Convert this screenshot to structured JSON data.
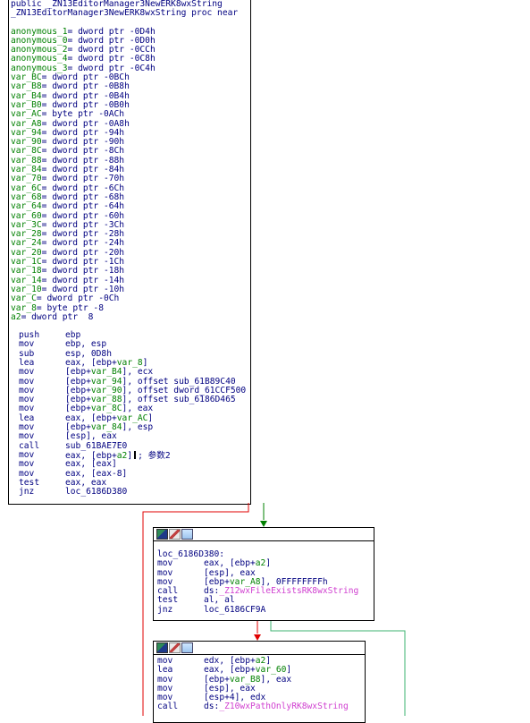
{
  "main_block": {
    "header_lines": [
      "public _ZN13EditorManager3NewERK8wxString",
      "_ZN13EditorManager3NewERK8wxString proc near"
    ],
    "vars": [
      [
        "anonymous_1",
        "= dword ptr -0D4h"
      ],
      [
        "anonymous_0",
        "= dword ptr -0D0h"
      ],
      [
        "anonymous_2",
        "= dword ptr -0CCh"
      ],
      [
        "anonymous_4",
        "= dword ptr -0C8h"
      ],
      [
        "anonymous_3",
        "= dword ptr -0C4h"
      ],
      [
        "var_BC",
        "= dword ptr -0BCh"
      ],
      [
        "var_B8",
        "= dword ptr -0B8h"
      ],
      [
        "var_B4",
        "= dword ptr -0B4h"
      ],
      [
        "var_B0",
        "= dword ptr -0B0h"
      ],
      [
        "var_AC",
        "= byte ptr -0ACh"
      ],
      [
        "var_A8",
        "= dword ptr -0A8h"
      ],
      [
        "var_94",
        "= dword ptr -94h"
      ],
      [
        "var_90",
        "= dword ptr -90h"
      ],
      [
        "var_8C",
        "= dword ptr -8Ch"
      ],
      [
        "var_88",
        "= dword ptr -88h"
      ],
      [
        "var_84",
        "= dword ptr -84h"
      ],
      [
        "var_70",
        "= dword ptr -70h"
      ],
      [
        "var_6C",
        "= dword ptr -6Ch"
      ],
      [
        "var_68",
        "= dword ptr -68h"
      ],
      [
        "var_64",
        "= dword ptr -64h"
      ],
      [
        "var_60",
        "= dword ptr -60h"
      ],
      [
        "var_3C",
        "= dword ptr -3Ch"
      ],
      [
        "var_28",
        "= dword ptr -28h"
      ],
      [
        "var_24",
        "= dword ptr -24h"
      ],
      [
        "var_20",
        "= dword ptr -20h"
      ],
      [
        "var_1C",
        "= dword ptr -1Ch"
      ],
      [
        "var_18",
        "= dword ptr -18h"
      ],
      [
        "var_14",
        "= dword ptr -14h"
      ],
      [
        "var_10",
        "= dword ptr -10h"
      ],
      [
        "var_C",
        "= dword ptr -0Ch"
      ],
      [
        "var_8",
        "= byte ptr -8"
      ],
      [
        "a2",
        "= dword ptr  8"
      ]
    ],
    "instructions": [
      {
        "op": "push",
        "args": "ebp"
      },
      {
        "op": "mov",
        "args": "ebp, esp"
      },
      {
        "op": "sub",
        "args": "esp, 0D8h"
      },
      {
        "op": "lea",
        "args": "eax, [ebp+var_8]"
      },
      {
        "op": "mov",
        "args": "[ebp+var_B4], ecx"
      },
      {
        "op": "mov",
        "args": "[ebp+var_94], offset sub_61B89C40"
      },
      {
        "op": "mov",
        "args": "[ebp+var_90], offset dword_61CCF500"
      },
      {
        "op": "mov",
        "args": "[ebp+var_88], offset sub_6186D465"
      },
      {
        "op": "mov",
        "args": "[ebp+var_8C], eax"
      },
      {
        "op": "lea",
        "args": "eax, [ebp+var_AC]"
      },
      {
        "op": "mov",
        "args": "[ebp+var_84], esp"
      },
      {
        "op": "mov",
        "args": "[esp], eax"
      },
      {
        "op": "call",
        "args": "sub_61BAE7E0"
      },
      {
        "op": "mov",
        "args": "eax, [ebp+a2]",
        "comment": "; 参数2"
      },
      {
        "op": "mov",
        "args": "eax, [eax]"
      },
      {
        "op": "mov",
        "args": "eax, [eax-8]"
      },
      {
        "op": "test",
        "args": "eax, eax"
      },
      {
        "op": "jnz",
        "args": "loc_6186D380"
      }
    ]
  },
  "block2": {
    "label": "loc_6186D380:",
    "instructions": [
      {
        "op": "mov",
        "args": "eax, [ebp+a2]"
      },
      {
        "op": "mov",
        "args": "[esp], eax"
      },
      {
        "op": "mov",
        "args": "[ebp+var_A8], 0FFFFFFFFh"
      },
      {
        "op": "call",
        "args_prefix": "ds:",
        "args_import": "_Z12wxFileExistsRK8wxString"
      },
      {
        "op": "test",
        "args": "al, al"
      },
      {
        "op": "jnz",
        "args": "loc_6186CF9A"
      }
    ]
  },
  "block3": {
    "instructions": [
      {
        "op": "mov",
        "args": "edx, [ebp+a2]"
      },
      {
        "op": "lea",
        "args": "eax, [ebp+var_60]"
      },
      {
        "op": "mov",
        "args": "[ebp+var_B8], eax"
      },
      {
        "op": "mov",
        "args": "[esp], eax"
      },
      {
        "op": "mov",
        "args": "[esp+4], edx"
      },
      {
        "op": "call",
        "args_prefix": "ds:",
        "args_import": "_Z10wxPathOnlyRK8wxString"
      }
    ]
  },
  "colors": {
    "green_edge": "#008000",
    "red_edge": "#e00000",
    "light_green_edge": "#3cb371",
    "import": "#d040d0"
  }
}
